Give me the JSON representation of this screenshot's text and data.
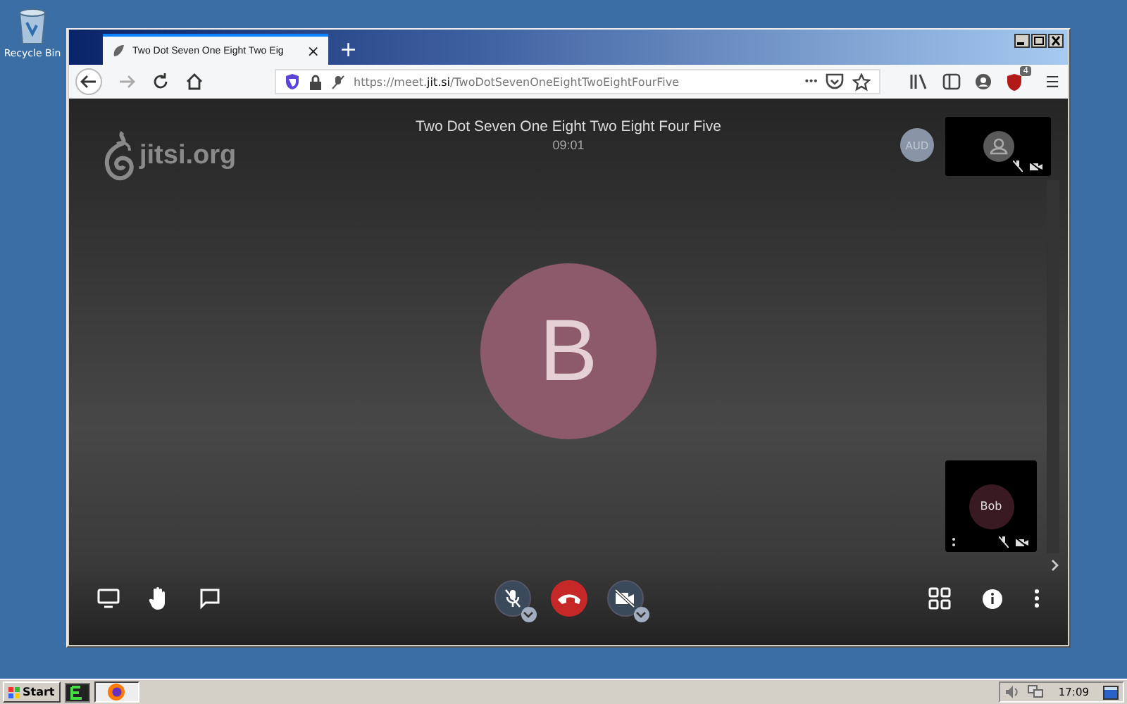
{
  "desktop_icons": [
    {
      "label": "Recycle Bin"
    }
  ],
  "browser": {
    "tab_title": "Two Dot Seven One Eight Two Eig",
    "tab_close": "×",
    "new_tab": "+",
    "url_prefix": "https://meet.",
    "url_domain": "jit.si",
    "url_path": "/TwoDotSevenOneEightTwoEightFourFive",
    "more": "•••",
    "menu": "☰",
    "extension_badge": "4"
  },
  "meeting": {
    "logo": "jitsi.org",
    "title": "Two Dot Seven One Eight Two Eight Four Five",
    "timer": "09:01",
    "speaker_initial": "B",
    "audience_badge": "AUD",
    "tiles": [
      {
        "kind": "placeholder"
      },
      {
        "kind": "named",
        "name": "Bob"
      }
    ]
  },
  "taskbar": {
    "start": "Start",
    "clock": "17:09"
  }
}
